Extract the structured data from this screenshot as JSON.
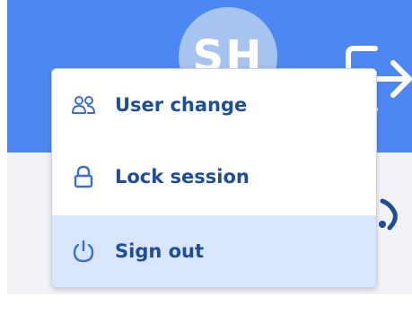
{
  "header": {
    "avatar_initials": "SH",
    "exit_icon": "exit-icon"
  },
  "menu": {
    "items": [
      {
        "label": "User change",
        "icon": "user-change-icon",
        "selected": false
      },
      {
        "label": "Lock session",
        "icon": "lock-icon",
        "selected": false
      },
      {
        "label": "Sign out",
        "icon": "power-icon",
        "selected": true
      }
    ]
  },
  "colors": {
    "header_blue": "#4d88f2",
    "menu_text": "#1e4d9a",
    "selected_bg": "#d8e6ff"
  }
}
